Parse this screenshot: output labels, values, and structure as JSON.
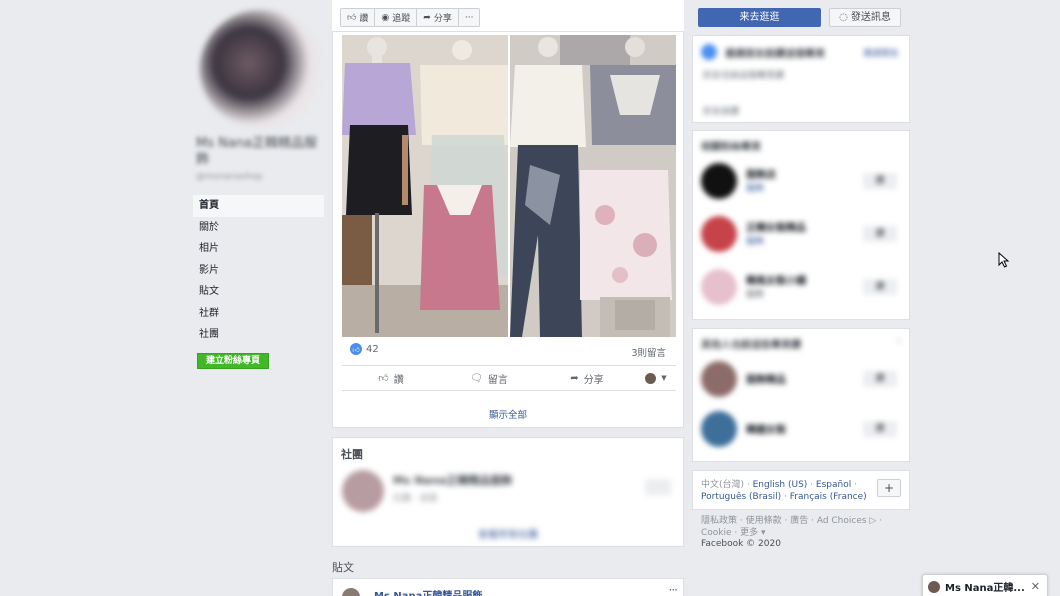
{
  "page": {
    "name": "Ms Nana正韓精品服飾",
    "handle": "@msnanashop"
  },
  "nav": {
    "items": [
      "首頁",
      "關於",
      "相片",
      "影片",
      "貼文",
      "社群",
      "社團"
    ],
    "create_page_label": "建立粉絲專頁"
  },
  "toolbar": {
    "like_label": "讚",
    "follow_label": "追蹤",
    "share_label": "分享",
    "more_label": "···",
    "primary_cta_label": "来去逛逛",
    "message_label": "發送訊息"
  },
  "post": {
    "reaction_count": "42",
    "comment_count": "3則留言",
    "actions": {
      "like": "讚",
      "comment": "留言",
      "share": "分享"
    },
    "show_all": "顯示全部"
  },
  "groups": {
    "title": "社團",
    "item_name": "Ms Nana正韓精品服飾",
    "item_meta": "社團 · 成員",
    "see_all": "查看所有社團"
  },
  "posts_section": {
    "heading": "貼文",
    "author": "Ms Nana正韓精品服飾",
    "more_label": "···"
  },
  "right": {
    "invite_card": {
      "title": "邀請朋友說讚這個專頁",
      "action": "邀請朋友",
      "line1": "好友也說這個專頁讚",
      "line2": "好友說讚"
    },
    "related_pages": {
      "title": "相關粉絲專頁",
      "items": [
        {
          "name": "服飾店",
          "meta": "服飾",
          "button": "讚"
        },
        {
          "name": "正韓女裝精品",
          "meta": "服飾",
          "button": "讚"
        },
        {
          "name": "韓風女裝小舖",
          "meta": "服飾",
          "button": "讚"
        }
      ]
    },
    "people_also": {
      "title": "其他人也說這些專頁讚",
      "items": [
        {
          "name": "服飾精品",
          "button": "讚"
        },
        {
          "name": "韓國女裝",
          "button": "讚"
        }
      ]
    },
    "languages": {
      "current": "中文(台灣)",
      "links": [
        "English (US)",
        "Español",
        "Português (Brasil)",
        "Français (France)"
      ],
      "add_label": "+"
    },
    "footer": {
      "links": [
        "隱私政策",
        "使用條款",
        "廣告",
        "Ad Choices ▷",
        "Cookie",
        "更多 ▾"
      ],
      "copyright": "Facebook © 2020"
    }
  },
  "chat": {
    "name": "Ms Nana正韓...",
    "close_label": "✕"
  },
  "colors": {
    "brand_blue": "#4267b2",
    "link_blue": "#385898",
    "green": "#42b72a",
    "background": "#e9ebee"
  }
}
